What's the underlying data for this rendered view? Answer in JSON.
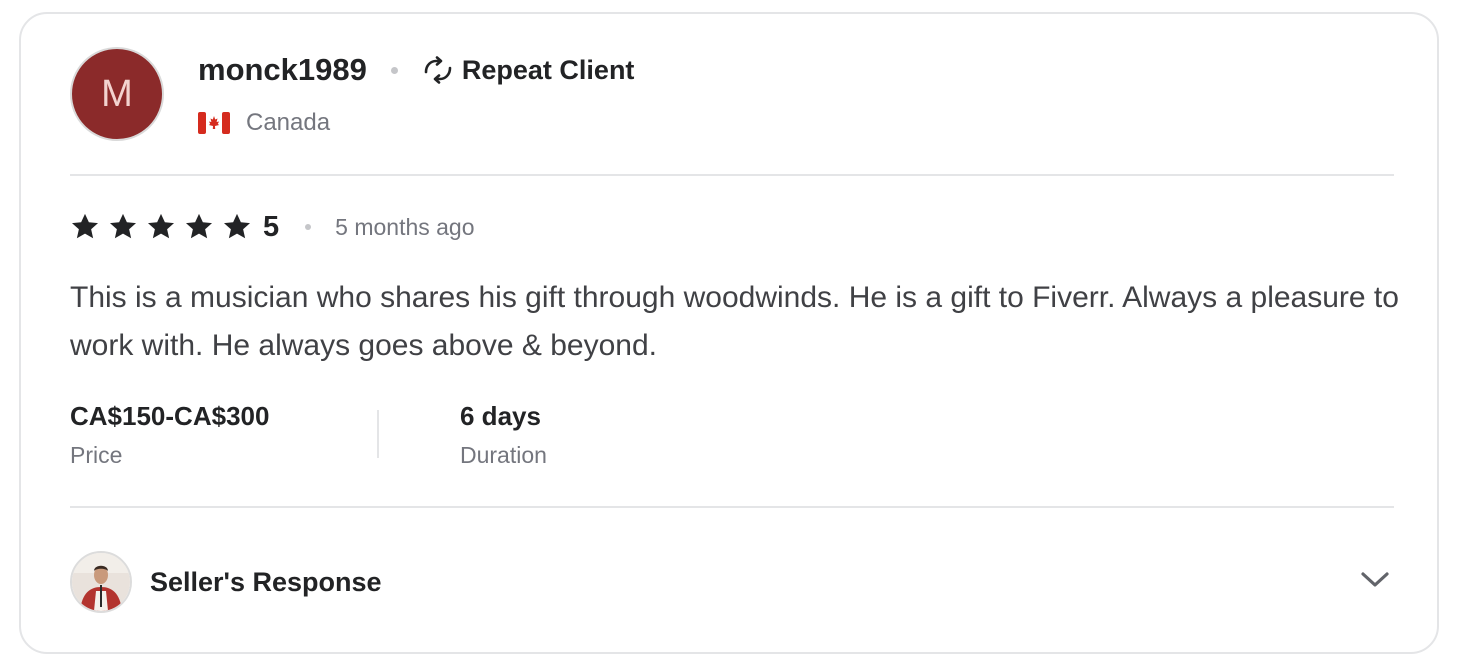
{
  "reviewer": {
    "avatar_initial": "M",
    "username": "monck1989",
    "badge_label": "Repeat Client",
    "country": "Canada",
    "colors": {
      "avatar_bg": "#8b2a2a",
      "avatar_text": "#f3d3cf"
    }
  },
  "review": {
    "rating": 5,
    "rating_display": "5",
    "date": "5 months ago",
    "text": "This is a musician who shares his gift through woodwinds. He is a gift to Fiverr. Always a pleasure to work with. He always goes above & beyond."
  },
  "meta": {
    "price_value": "CA$150-CA$300",
    "price_label": "Price",
    "duration_value": "6 days",
    "duration_label": "Duration"
  },
  "seller_response": {
    "label": "Seller's Response",
    "expand_icon": "chevron-down-icon"
  },
  "icons": {
    "badge": "repeat-icon",
    "flag": "canada-flag-icon",
    "star": "star-icon"
  }
}
